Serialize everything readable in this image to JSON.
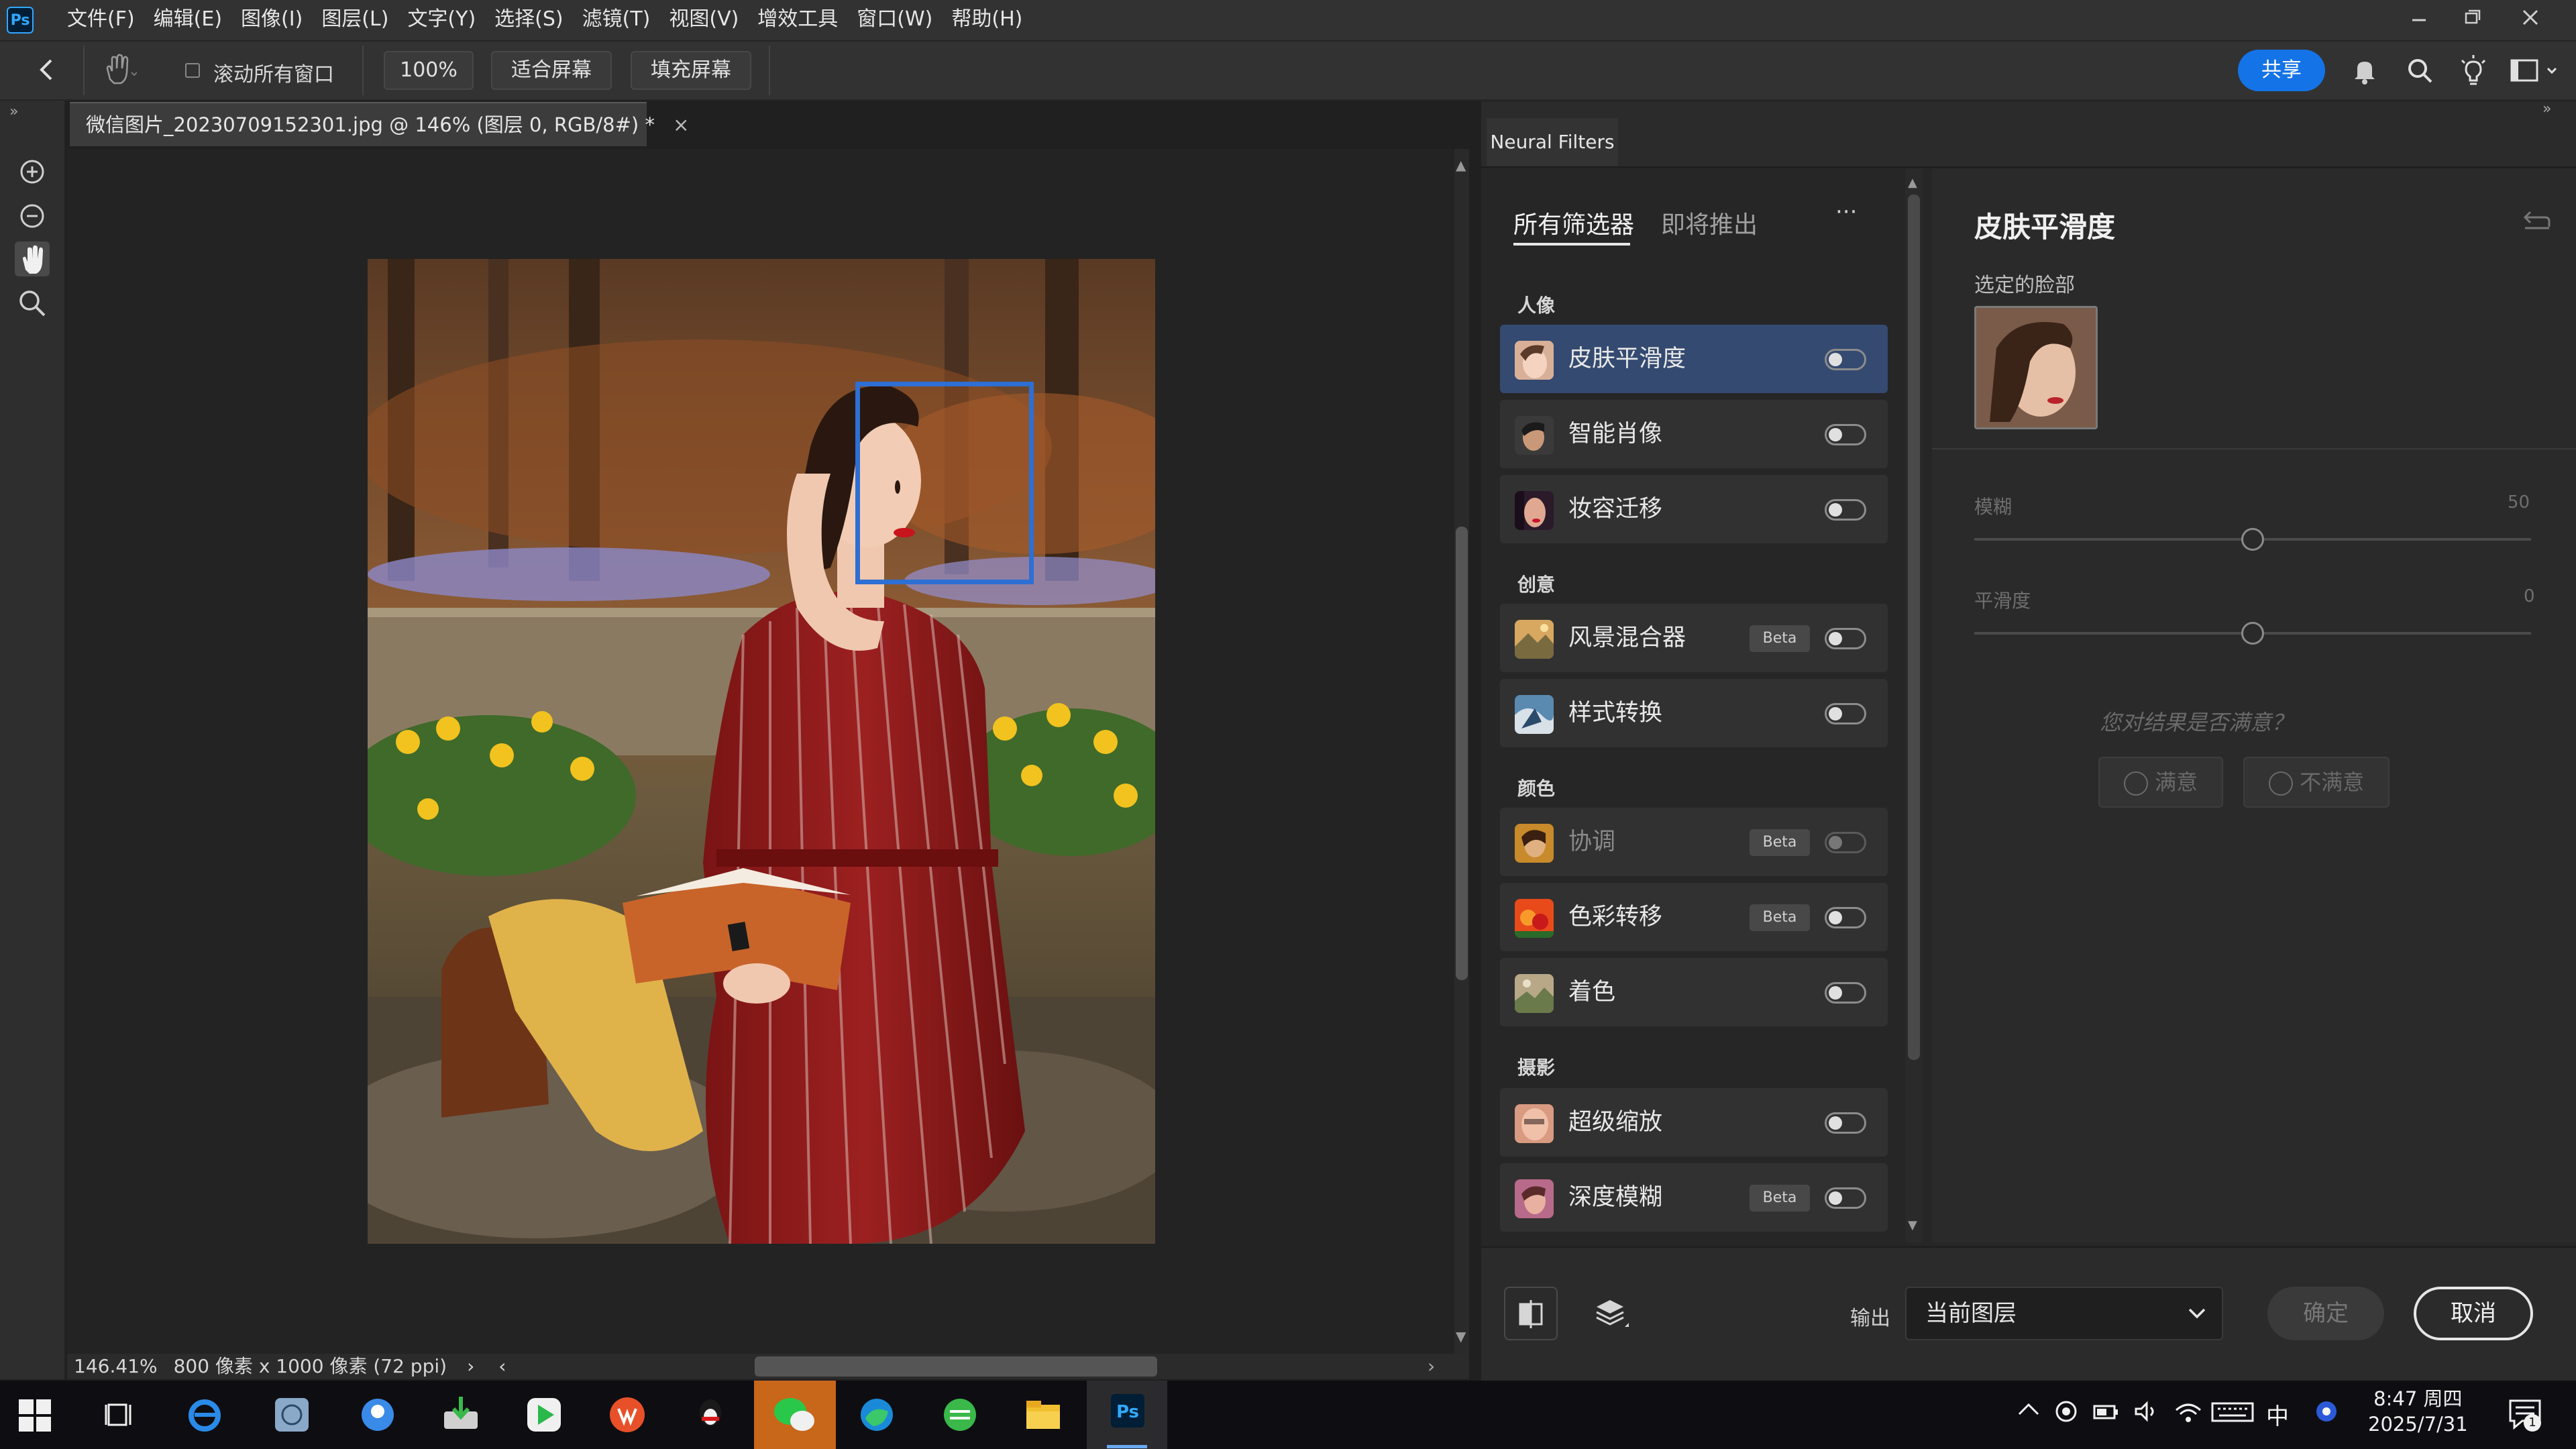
{
  "app": {
    "logo": "Ps",
    "menu": [
      "文件(F)",
      "编辑(E)",
      "图像(I)",
      "图层(L)",
      "文字(Y)",
      "选择(S)",
      "滤镜(T)",
      "视图(V)",
      "增效工具",
      "窗口(W)",
      "帮助(H)"
    ]
  },
  "options": {
    "scroll_all_label": "滚动所有窗口",
    "zoom_value": "100%",
    "fit_screen": "适合屏幕",
    "fill_screen": "填充屏幕",
    "share_label": "共享"
  },
  "document": {
    "tab_title": "微信图片_20230709152301.jpg @ 146% (图层 0, RGB/8#) *",
    "tab_close": "×",
    "status_zoom": "146.41%",
    "status_info": "800 像素 x 1000 像素 (72 ppi)",
    "status_arrow": "›",
    "status_left": "‹"
  },
  "neural_filters": {
    "panel_tab": "Neural Filters",
    "tab_all": "所有筛选器",
    "tab_coming": "即将推出",
    "more": "···",
    "categories": [
      {
        "label": "人像",
        "filters": [
          {
            "name": "皮肤平滑度",
            "beta": "",
            "selected": true,
            "dim": false
          },
          {
            "name": "智能肖像",
            "beta": "",
            "selected": false,
            "dim": false
          },
          {
            "name": "妆容迁移",
            "beta": "",
            "selected": false,
            "dim": false
          }
        ]
      },
      {
        "label": "创意",
        "filters": [
          {
            "name": "风景混合器",
            "beta": "Beta",
            "selected": false,
            "dim": false
          },
          {
            "name": "样式转换",
            "beta": "",
            "selected": false,
            "dim": false
          }
        ]
      },
      {
        "label": "颜色",
        "filters": [
          {
            "name": "协调",
            "beta": "Beta",
            "selected": false,
            "dim": true
          },
          {
            "name": "色彩转移",
            "beta": "Beta",
            "selected": false,
            "dim": false
          },
          {
            "name": "着色",
            "beta": "",
            "selected": false,
            "dim": false
          }
        ]
      },
      {
        "label": "摄影",
        "filters": [
          {
            "name": "超级缩放",
            "beta": "",
            "selected": false,
            "dim": false
          },
          {
            "name": "深度模糊",
            "beta": "Beta",
            "selected": false,
            "dim": false
          }
        ]
      }
    ],
    "settings": {
      "title": "皮肤平滑度",
      "selected_face_label": "选定的脸部",
      "blur_label": "模糊",
      "blur_value": "50",
      "blur_fraction": 0.5,
      "smooth_label": "平滑度",
      "smooth_value": "0",
      "smooth_fraction": 0.5,
      "question": "您对结果是否满意？",
      "satisfied": "满意",
      "unsatisfied": "不满意"
    },
    "footer": {
      "output_label": "输出",
      "output_value": "当前图层",
      "ok_label": "确定",
      "cancel_label": "取消"
    }
  },
  "taskbar": {
    "ime": "中",
    "time": "8:47 周四",
    "date": "2025/7/31",
    "notif_count": "1"
  },
  "colors": {
    "accent": "#1473e6",
    "selected_row": "#344a70",
    "face_box": "#2e6fd3"
  }
}
